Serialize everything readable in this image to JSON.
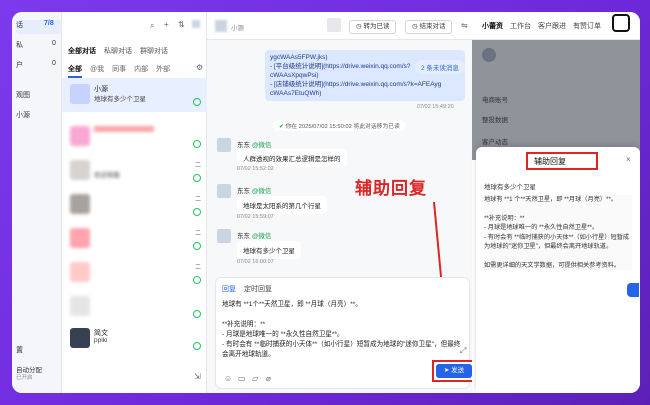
{
  "nav": {
    "items": [
      {
        "label": "话",
        "count": "7/8"
      },
      {
        "label": "私",
        "count": "0"
      },
      {
        "label": "户",
        "count": "0"
      },
      {
        "label": "观图"
      },
      {
        "label": "小源"
      }
    ],
    "bottom1": "置",
    "bottom2": "自动分配",
    "bottom3": "已开启"
  },
  "convs": {
    "tabs": [
      "全部对话",
      "私聊对话",
      "群聊对话"
    ],
    "subtabs": [
      "全部",
      "@我",
      "同事",
      "内部",
      "外部"
    ],
    "rows": [
      {
        "name": "小源",
        "text": "地球有多少个卫星",
        "selected": true
      },
      {
        "name": "",
        "text": "",
        "selected": false
      },
      {
        "name": "",
        "text": "欢迎观看",
        "selected": false
      },
      {
        "name": "",
        "text": "",
        "selected": false
      },
      {
        "name": "",
        "text": "",
        "selected": false
      },
      {
        "name": "",
        "text": "",
        "selected": false
      },
      {
        "name": "",
        "text": "",
        "selected": false
      },
      {
        "name": "简文",
        "text": "pplki",
        "selected": false
      }
    ],
    "row_tags": [
      "二",
      "二",
      "二",
      "二"
    ]
  },
  "chat": {
    "title": "小源",
    "btn_transfer": "转为已读",
    "btn_end": "结束对话",
    "link_lines": [
      "ygcWAAs5FPW.jks)",
      "- [平台级统计说明](https://drive.weixin.qq.com/s?",
      "cWAAsXpqwPsi)",
      "- [店铺级统计说明](https://drive.weixin.qq.com/s?k=AFEAyg",
      "cWAAs7EtuQWh)"
    ],
    "ts_top": "07/02 15:49:20",
    "new_msg": "2 条未读消息",
    "sys_msg": "你在 2025/07/02 15:50:02 将此对话移为已读",
    "messages": [
      {
        "sender": "东东",
        "tag": "@微信",
        "text": "人群透视的效果汇总逻辑是怎样的",
        "ts": "07/02 15:52:02"
      },
      {
        "sender": "东东",
        "tag": "@微信",
        "text": "地球是太阳系的第几个行星",
        "ts": "07/02 15:59:07"
      },
      {
        "sender": "东东",
        "tag": "@微信",
        "text": "地球有多少个卫星",
        "ts": "07/02 16:00:07"
      }
    ],
    "annotation": "辅助回复",
    "composer": {
      "tab_reply": "回复",
      "tab_timed": "定时回复",
      "text": "地球有 **1个**天然卫星，即 **月球（月亮）**。\n\n**补充说明：**\n- 月球是地球唯一的 **永久性自然卫星**。\n- 有时会有 **临时捕获的小天体**（如小行星）短暂成为地球的\"迷你卫星\"，但最终会离开地球轨道。",
      "send": "发送"
    }
  },
  "right": {
    "tabs": [
      "小蕾资",
      "工作台",
      "客户跟进",
      "有赞订单"
    ],
    "labels": [
      "电商账号",
      "整投数据",
      "客户动态"
    ],
    "assist": {
      "title": "辅助回复",
      "question": "地球有多少个卫星",
      "answer": "地球有 **1 个**天然卫星，即 **月球（月亮）**。\n\n**补充说明：**\n- 月球是地球唯一的 **永久性自然卫星**。\n- 有时会有 **临时捕获的小天体**（如小行星）短暂成为地球的\"迷你卫星\"，但最终会离开地球轨道。\n\n如需更详细的天文学数据，可提供相关参考资料。"
    }
  }
}
